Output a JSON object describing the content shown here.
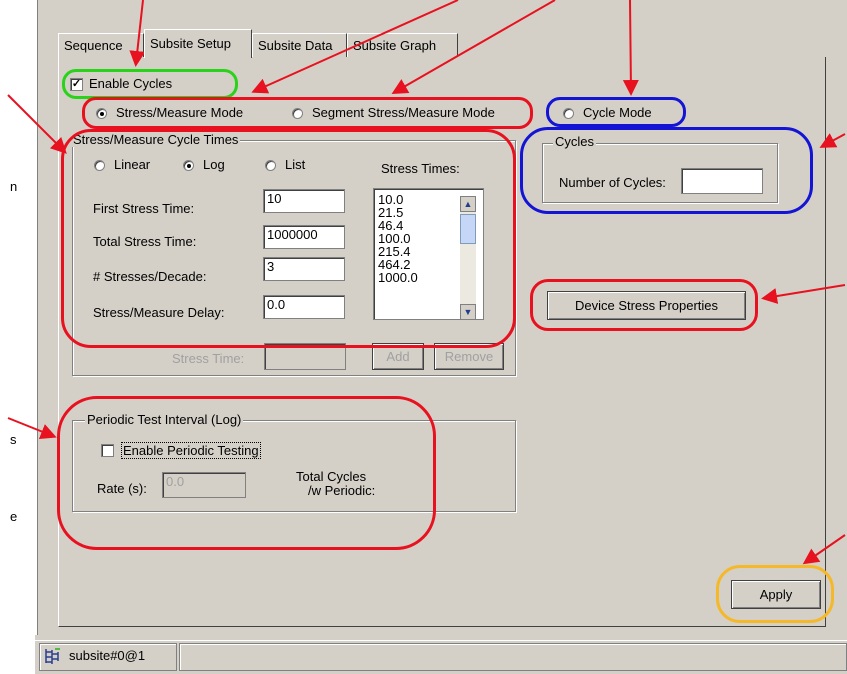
{
  "colors": {
    "highlight_red": "#e8111f",
    "highlight_green": "#2ad21a",
    "highlight_blue": "#1414d4",
    "highlight_orange": "#f5b829",
    "dialog_bg": "#d4d0c8"
  },
  "tabs": [
    {
      "label": "Sequence"
    },
    {
      "label": "Subsite Setup"
    },
    {
      "label": "Subsite Data"
    },
    {
      "label": "Subsite Graph"
    }
  ],
  "enable_cycles": {
    "label": "Enable Cycles",
    "checked": true
  },
  "mode": {
    "stress_measure": "Stress/Measure Mode",
    "segment_stress_measure": "Segment Stress/Measure Mode",
    "cycle": "Cycle Mode",
    "selected": "stress_measure"
  },
  "cycle_times": {
    "title": "Stress/Measure Cycle Times",
    "scale_options": [
      "Linear",
      "Log",
      "List"
    ],
    "selected_scale": "Log",
    "stress_times_label": "Stress Times:",
    "first_stress_time_label": "First Stress Time:",
    "first_stress_time_value": "10",
    "total_stress_time_label": "Total Stress Time:",
    "total_stress_time_value": "1000000",
    "stresses_per_decade_label": "# Stresses/Decade:",
    "stresses_per_decade_value": "3",
    "stress_measure_delay_label": "Stress/Measure Delay:",
    "stress_measure_delay_value": "0.0",
    "stress_times": [
      "10.0",
      "21.5",
      "46.4",
      "100.0",
      "215.4",
      "464.2",
      "1000.0"
    ],
    "stress_time_label": "Stress Time:",
    "stress_time_value": "",
    "add_button": "Add",
    "remove_button": "Remove"
  },
  "cycles": {
    "title": "Cycles",
    "number_of_cycles_label": "Number of Cycles:",
    "number_of_cycles_value": ""
  },
  "device_stress_properties_button": "Device Stress Properties",
  "periodic": {
    "title": "Periodic Test Interval (Log)",
    "enable_label": "Enable Periodic Testing",
    "enable_checked": false,
    "rate_label": "Rate (s):",
    "rate_value": "0.0",
    "total_cycles_label_line1": "Total Cycles",
    "total_cycles_label_line2": "/w Periodic:"
  },
  "apply_button": "Apply",
  "status_bar": {
    "subsite_label": "subsite#0@1",
    "icon": "subsite-tree-icon"
  },
  "side_text": {
    "left_1": "n",
    "left_2": "s",
    "left_3": "e"
  }
}
